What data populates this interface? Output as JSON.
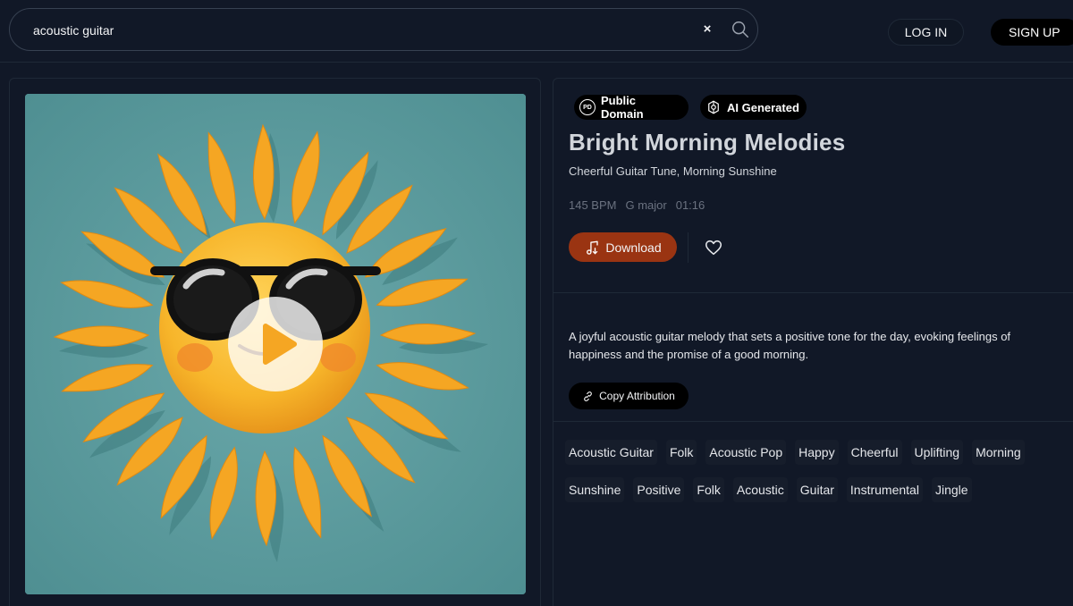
{
  "header": {
    "search": {
      "value": "acoustic guitar",
      "clear_label": "×"
    },
    "login_label": "LOG IN",
    "signup_label": "SIGN UP"
  },
  "track": {
    "badges": [
      {
        "label": "Public Domain",
        "icon": "public-domain-icon",
        "icon_text": "PD"
      },
      {
        "label": "AI Generated",
        "icon": "ai-generated-icon"
      }
    ],
    "title": "Bright Morning Melodies",
    "subtitle": "Cheerful Guitar Tune, Morning Sunshine",
    "meta": {
      "bpm": "145 BPM",
      "key": "G major",
      "duration": "01:16"
    },
    "download_label": "Download",
    "description": "A joyful acoustic guitar melody that sets a positive tone for the day, evoking feelings of happiness and the promise of a good morning.",
    "copy_attribution_label": "Copy Attribution",
    "tags": [
      "Acoustic Guitar",
      "Folk",
      "Acoustic Pop",
      "Happy",
      "Cheerful",
      "Uplifting",
      "Morning",
      "Sunshine",
      "Positive",
      "Folk",
      "Acoustic",
      "Guitar",
      "Instrumental",
      "Jingle"
    ]
  },
  "colors": {
    "background": "#111827",
    "accent_download": "#9a3412",
    "cover_background": "#5a9a9c",
    "sun": "#f7b52a"
  }
}
